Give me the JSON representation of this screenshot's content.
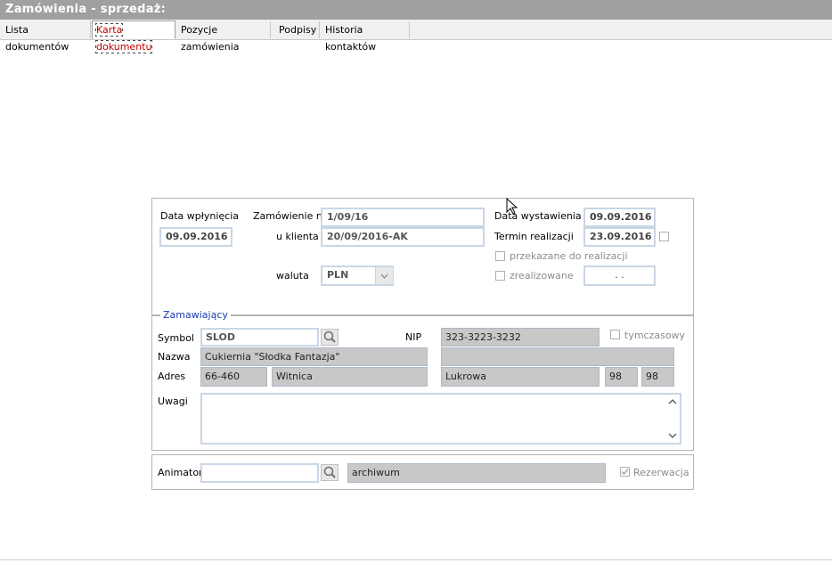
{
  "window": {
    "title": "Zamówienia - sprzedaż:"
  },
  "tabs": [
    {
      "label": "Lista dokumentów"
    },
    {
      "label": "Karta dokumentu"
    },
    {
      "label": "Pozycje zamówienia"
    },
    {
      "label": "Podpisy"
    },
    {
      "label": "Historia kontaktów"
    }
  ],
  "doc": {
    "date_received_label": "Data wpłynięcia",
    "date_received": "09.09.2016",
    "order_no_label": "Zamówienie nr",
    "order_no": "1/09/16",
    "client_label": "u klienta",
    "client_no": "20/09/2016-AK",
    "currency_label": "waluta",
    "currency": "PLN",
    "issue_date_label": "Data wystawienia",
    "issue_date": "09.09.2016",
    "due_label": "Termin realizacji",
    "due_date": "23.09.2016",
    "transferred_label": "przekazane do realizacji",
    "completed_label": "zrealizowane",
    "completed_date": " .  ."
  },
  "orderer": {
    "legend": "Zamawiający",
    "symbol_label": "Symbol",
    "symbol": "SLOD",
    "nip_label": "NIP",
    "nip": "323-3223-3232",
    "temp_label": "tymczasowy",
    "name_label": "Nazwa",
    "name": "Cukiernia \"Słodka Fantazja\"",
    "address_label": "Adres",
    "postal_code": "66-460",
    "city": "Witnica",
    "street": "Lukrowa",
    "house_no": "98",
    "flat_no": "98",
    "notes_label": "Uwagi",
    "notes": ""
  },
  "animator": {
    "label": "Animator",
    "value": "",
    "archive": "archiwum",
    "reservation_label": "Rezerwacja"
  },
  "icons": {
    "search": "magnifier-icon",
    "dropdown": "chevron-down-icon",
    "scroll_up": "chevron-up-icon",
    "scroll_down": "chevron-down-icon",
    "check": "check-icon"
  }
}
